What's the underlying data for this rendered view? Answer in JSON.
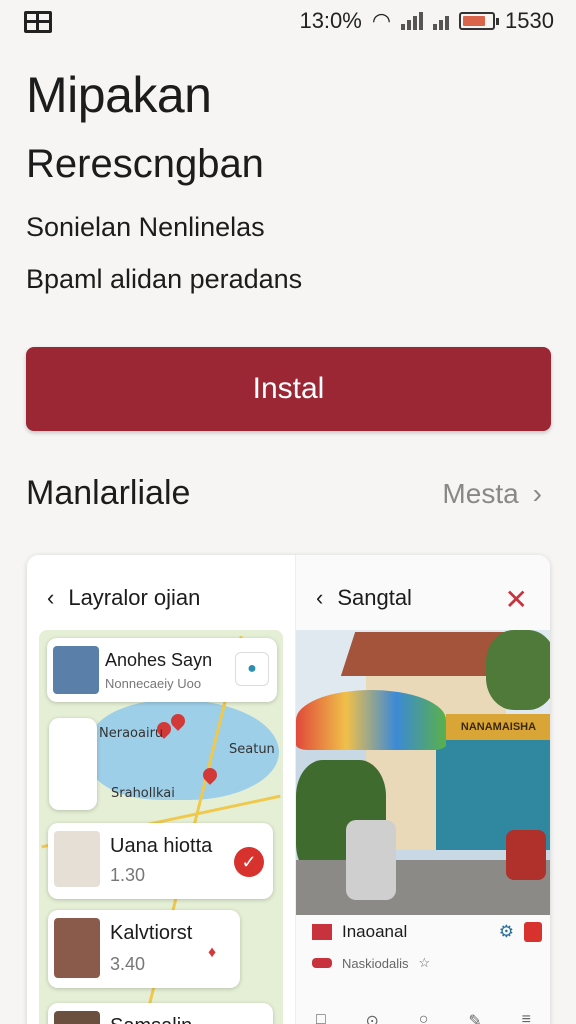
{
  "status": {
    "left_text": "13:0%",
    "right_text": "1530",
    "accent": "#d9644a"
  },
  "app": {
    "title": "Mipakan",
    "subtitle": "Rerescngban",
    "line1": "Sonielan Nenlinelas",
    "line2": "Bpaml alidan peradans",
    "install_label": "Instal",
    "brand_color": "#9b2735"
  },
  "section": {
    "title": "Manlarliale",
    "more_label": "Mesta"
  },
  "preview": {
    "left": {
      "header": "Layralor ojian",
      "top_card": {
        "title": "Anohes Sayn",
        "subtitle": "Nonnecaeiy Uoo"
      },
      "map_labels": [
        "Neraoairu",
        "Seatun",
        "Srahollkai"
      ],
      "cards": [
        {
          "title": "Uana hiotta",
          "meta": "1.30"
        },
        {
          "title": "Kalvtiorst",
          "meta": "3.40"
        },
        {
          "title": "Samsalin",
          "meta": ""
        }
      ]
    },
    "right": {
      "header": "Sangtal",
      "sign_text": "NANAMAISHA",
      "row1": "Inaoanal",
      "row2": "Naskiodalis"
    }
  }
}
